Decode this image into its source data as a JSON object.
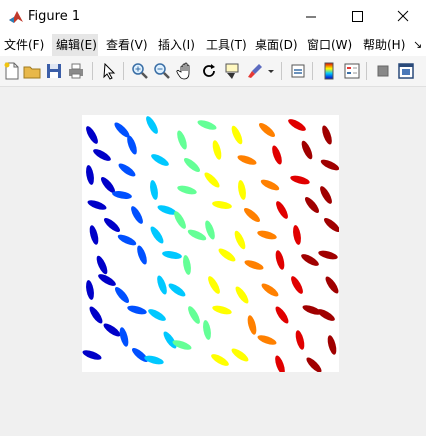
{
  "window": {
    "title": "Figure 1"
  },
  "menu": [
    {
      "label": "文件(F)"
    },
    {
      "label": "编辑(E)"
    },
    {
      "label": "查看(V)"
    },
    {
      "label": "插入(I)"
    },
    {
      "label": "工具(T)"
    },
    {
      "label": "桌面(D)"
    },
    {
      "label": "窗口(W)"
    },
    {
      "label": "帮助(H)"
    }
  ],
  "toolbar_icons": [
    "new-figure-icon",
    "open-file-icon",
    "save-icon",
    "print-icon",
    "select-pointer-icon",
    "zoom-in-icon",
    "zoom-out-icon",
    "pan-hand-icon",
    "rotate-3d-icon",
    "data-cursor-icon",
    "brush-icon",
    "link-plot-icon",
    "colorbar-icon",
    "legend-icon",
    "hide-plot-tools-icon",
    "show-plot-tools-icon"
  ],
  "image": {
    "description_colormap": "jet",
    "colors": [
      "#0000c8",
      "#0050ff",
      "#00c8ff",
      "#64ff96",
      "#ffff00",
      "#ff8000",
      "#e00000",
      "#a00000"
    ]
  }
}
